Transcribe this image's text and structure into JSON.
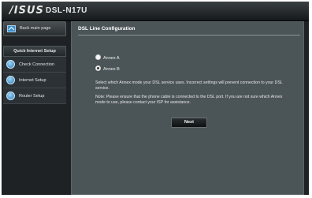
{
  "header": {
    "brand": "/ISUS",
    "model": "DSL-N17U"
  },
  "sidebar": {
    "back_label": "Back main page",
    "section_title": "Quick Internet Setup",
    "items": [
      {
        "label": "Check Connection"
      },
      {
        "label": "Internet Setup"
      },
      {
        "label": "Router Setup"
      }
    ]
  },
  "main": {
    "title": "DSL Line Configuration",
    "options": [
      {
        "label": "Annex A",
        "selected": false
      },
      {
        "label": "Annex B",
        "selected": true
      }
    ],
    "description": "Select which Annex mode your DSL service uses. Incorrect settings will prevent connection to your DSL service.",
    "note": "Note: Please ensure that the phone cable is connected to the DSL port. If you are not sure which Annex mode to use, please contact your ISP for assistance.",
    "next_label": "Next"
  },
  "colors": {
    "background": "#1e2224",
    "content_panel": "#4b5457",
    "accent_icon": "#2a78b8"
  }
}
